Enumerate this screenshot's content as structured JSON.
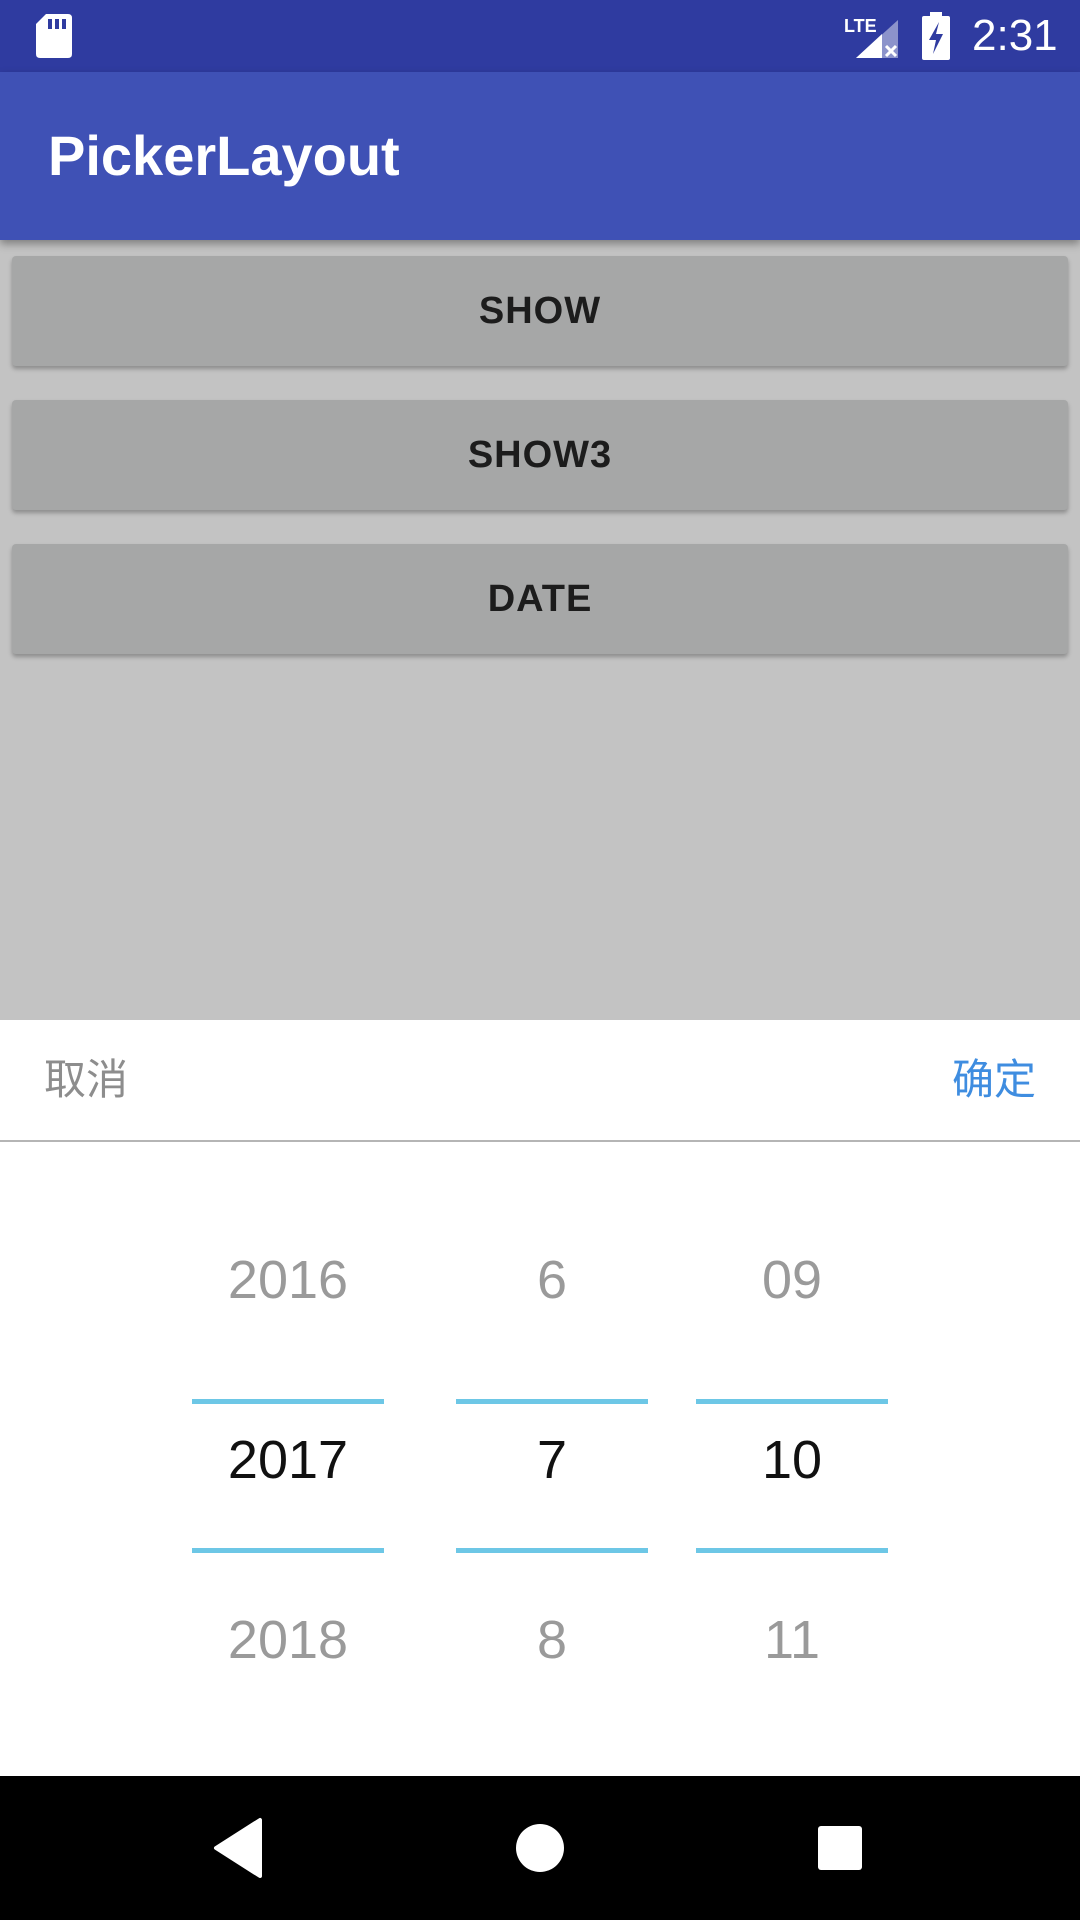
{
  "status_bar": {
    "time": "2:31",
    "icons": [
      "sd-card-icon",
      "lte-signal-icon",
      "battery-charging-icon"
    ],
    "network_label": "LTE",
    "background_color": "#2f3ba0"
  },
  "toolbar": {
    "title": "PickerLayout",
    "background_color": "#3f51b5"
  },
  "buttons": [
    {
      "label": "SHOW"
    },
    {
      "label": "SHOW3"
    },
    {
      "label": "DATE"
    }
  ],
  "picker": {
    "cancel_label": "取消",
    "confirm_label": "确定",
    "accent_color": "#3f8de0",
    "divider_color": "#6dc7e6",
    "columns": [
      {
        "name": "year",
        "prev": "2016",
        "selected": "2017",
        "next": "2018"
      },
      {
        "name": "month",
        "prev": "6",
        "selected": "7",
        "next": "8"
      },
      {
        "name": "day",
        "prev": "09",
        "selected": "10",
        "next": "11"
      }
    ]
  },
  "nav_bar": {
    "icons": [
      "back-icon",
      "home-icon",
      "recents-icon"
    ]
  }
}
